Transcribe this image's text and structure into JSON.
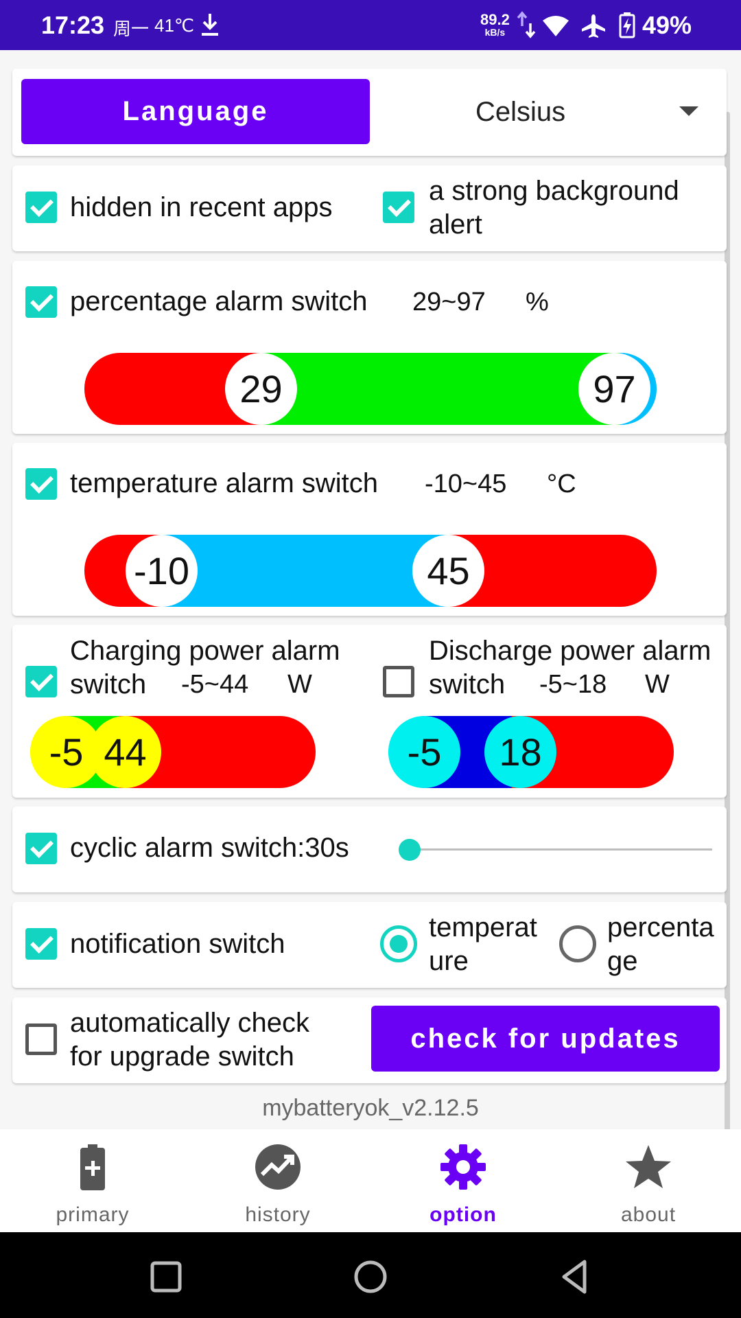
{
  "status_bar": {
    "time": "17:23",
    "date": "周一",
    "temperature": "41℃",
    "net_speed_value": "89.2",
    "net_speed_unit": "kB/s",
    "battery_percent": "49%",
    "icons": [
      "download-icon",
      "data-arrows-icon",
      "wifi-icon",
      "airplane-icon",
      "battery-charging-icon"
    ]
  },
  "settings": {
    "language_button": "Language",
    "temperature_unit": "Celsius",
    "hidden_recent_label": "hidden in recent apps",
    "strong_bg_alert_line1": "a strong background",
    "strong_bg_alert_line2": "alert",
    "percentage_alarm": {
      "label": "percentage alarm switch",
      "range": "29~97",
      "unit": "%",
      "low": "29",
      "high": "97",
      "checked": true
    },
    "temperature_alarm": {
      "label": "temperature alarm switch",
      "range": "-10~45",
      "unit": "°C",
      "low": "-10",
      "high": "45",
      "checked": true
    },
    "charging_alarm": {
      "label_line1": "Charging power alarm",
      "label_line2_prefix": "switch",
      "range": "-5~44",
      "unit": "W",
      "low": "-5",
      "high": "44",
      "checked": true
    },
    "discharge_alarm": {
      "label_line1": "Discharge power alarm",
      "label_line2_prefix": "switch",
      "range": "-5~18",
      "unit": "W",
      "low": "-5",
      "high": "18",
      "checked": false
    },
    "cyclic_alarm_label": "cyclic alarm switch:30s",
    "notification": {
      "label": "notification switch",
      "option_temperature_line1": "temperat",
      "option_temperature_line2": "ure",
      "option_percentage_line1": "percenta",
      "option_percentage_line2": "ge",
      "selected": "temperature"
    },
    "auto_check_line1": "automatically check",
    "auto_check_line2": "for upgrade switch",
    "check_updates_button": "check for updates",
    "version": "mybatteryok_v2.12.5"
  },
  "bottom_nav": {
    "items": [
      {
        "label": "primary",
        "icon": "battery-plus-icon"
      },
      {
        "label": "history",
        "icon": "trending-up-icon"
      },
      {
        "label": "option",
        "icon": "gear-icon",
        "active": true
      },
      {
        "label": "about",
        "icon": "star-icon"
      }
    ]
  },
  "colors": {
    "status_bar": "#3a0fb5",
    "primary_button": "#6a00f4",
    "accent": "#12d4c0",
    "red": "#ff0000",
    "green": "#00ee00",
    "light_blue": "#00bfff",
    "blue": "#0000e0",
    "yellow": "#ffff00",
    "cyan": "#00f0f0"
  }
}
